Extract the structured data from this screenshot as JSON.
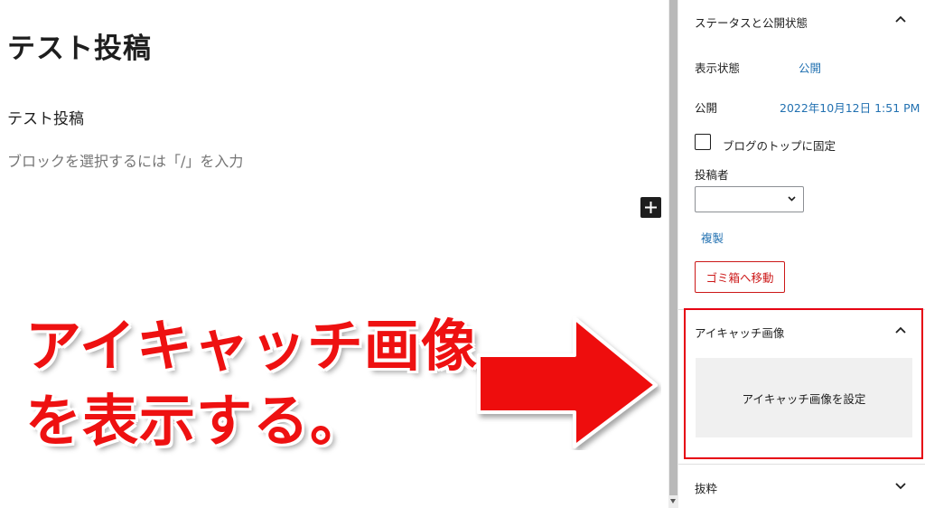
{
  "editor": {
    "post_title": "テスト投稿",
    "paragraph": "テスト投稿",
    "block_placeholder": "ブロックを選択するには「/」を入力"
  },
  "sidebar": {
    "status_panel": {
      "title": "ステータスと公開状態",
      "visibility_label": "表示状態",
      "visibility_value": "公開",
      "publish_label": "公開",
      "publish_value": "2022年10月12日 1:51 PM",
      "sticky_label": "ブログのトップに固定",
      "author_label": "投稿者",
      "author_value": "",
      "duplicate_link": "複製",
      "trash_button": "ゴミ箱へ移動"
    },
    "featured_panel": {
      "title": "アイキャッチ画像",
      "set_button": "アイキャッチ画像を設定"
    },
    "excerpt_panel": {
      "title": "抜粋"
    }
  },
  "annotation": {
    "line1": "アイキャッチ画像",
    "line2": "を表示する。"
  },
  "colors": {
    "accent": "#e60012",
    "link": "#2271b1",
    "danger": "#cc1818"
  }
}
